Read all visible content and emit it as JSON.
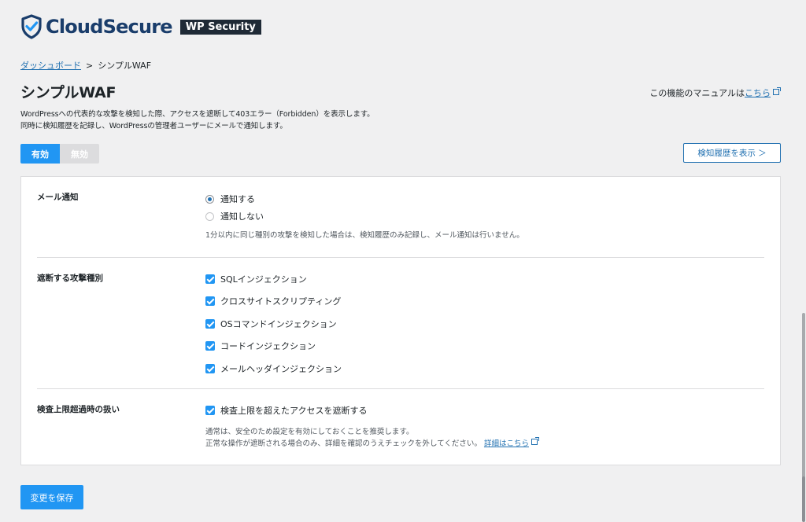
{
  "brand": {
    "name": "CloudSecure",
    "badge": "WP Security",
    "accent": "#2196f3",
    "logo_color": "#1a3d6b",
    "logo_icon": "shield-check-icon"
  },
  "breadcrumb": {
    "dashboard_link": "ダッシュボード",
    "separator": ">",
    "current": "シンプルWAF"
  },
  "header": {
    "title": "シンプルWAF",
    "manual_prefix": "この機能のマニュアルは",
    "manual_link": "こちら"
  },
  "description": {
    "line1": "WordPressへの代表的な攻撃を検知した際、アクセスを遮断して403エラー（Forbidden）を表示します。",
    "line2": "同時に検知履歴を記録し、WordPressの管理者ユーザーにメールで通知します。"
  },
  "toggle": {
    "on_label": "有効",
    "off_label": "無効",
    "state": "on"
  },
  "history_button": "検知履歴を表示 ＞",
  "settings": {
    "mail": {
      "label": "メール通知",
      "options": [
        {
          "label": "通知する",
          "checked": true
        },
        {
          "label": "通知しない",
          "checked": false
        }
      ],
      "note": "1分以内に同じ種別の攻撃を検知した場合は、検知履歴のみ記録し、メール通知は行いません。"
    },
    "attack_types": {
      "label": "遮断する攻撃種別",
      "items": [
        {
          "label": "SQLインジェクション",
          "checked": true
        },
        {
          "label": "クロスサイトスクリプティング",
          "checked": true
        },
        {
          "label": "OSコマンドインジェクション",
          "checked": true
        },
        {
          "label": "コードインジェクション",
          "checked": true
        },
        {
          "label": "メールヘッダインジェクション",
          "checked": true
        }
      ]
    },
    "limit": {
      "label": "検査上限超過時の扱い",
      "checkbox_label": "検査上限を超えたアクセスを遮断する",
      "checked": true,
      "note_line1": "通常は、安全のため設定を有効にしておくことを推奨します。",
      "note_line2": "正常な操作が遮断される場合のみ、詳細を確認のうえチェックを外してください。",
      "note_link": "詳細はこちら"
    }
  },
  "save_button": "変更を保存"
}
